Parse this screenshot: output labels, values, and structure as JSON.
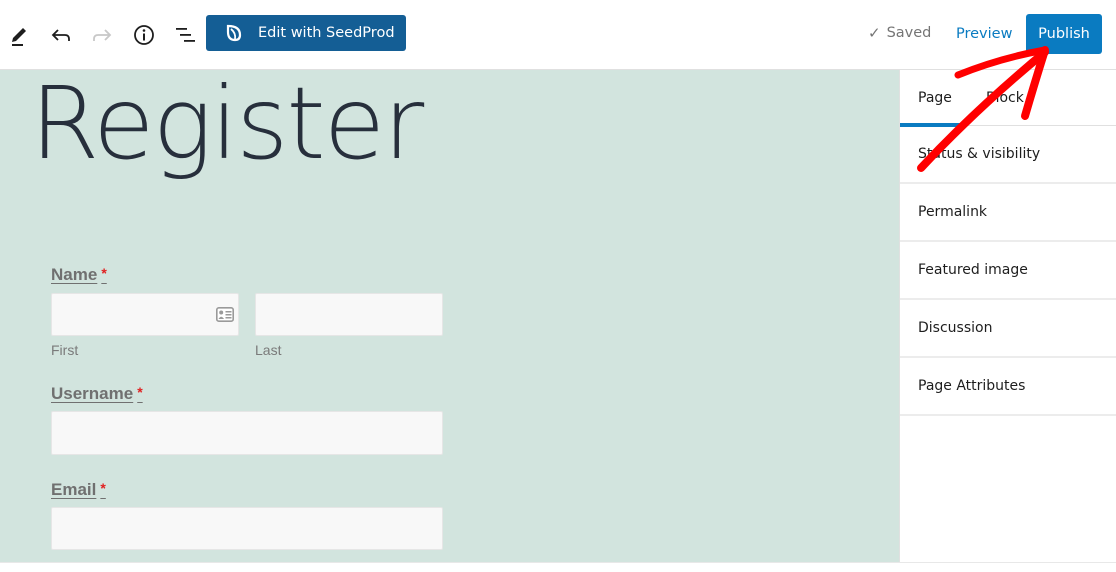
{
  "toolbar": {
    "tools": [
      {
        "name": "edit-tool",
        "icon": "pencil-icon"
      },
      {
        "name": "undo",
        "icon": "undo-icon"
      },
      {
        "name": "redo",
        "icon": "redo-icon",
        "disabled": true
      },
      {
        "name": "details",
        "icon": "info-icon"
      },
      {
        "name": "list-view",
        "icon": "list-view-icon"
      }
    ],
    "seedprod_label": "Edit with SeedProd",
    "saved_check": "✓",
    "saved_label": "Saved",
    "preview_label": "Preview",
    "publish_label": "Publish",
    "colors": {
      "seedprod": "#145e95",
      "publish": "#0a7bc1",
      "preview": "#0a7bc1"
    }
  },
  "canvas": {
    "background": "#d2e4de",
    "title": "Register",
    "form": {
      "name": {
        "label": "Name",
        "required": "*",
        "first_label": "First",
        "last_label": "Last",
        "first_value": "",
        "last_value": ""
      },
      "username": {
        "label": "Username",
        "required": "*",
        "value": ""
      },
      "email": {
        "label": "Email",
        "required": "*",
        "value": ""
      }
    }
  },
  "sidebar": {
    "tabs": [
      {
        "label": "Page",
        "active": true
      },
      {
        "label": "Block",
        "active": false
      }
    ],
    "panels": [
      {
        "label": "Status & visibility"
      },
      {
        "label": "Permalink"
      },
      {
        "label": "Featured image"
      },
      {
        "label": "Discussion"
      },
      {
        "label": "Page Attributes"
      }
    ]
  },
  "annotation": {
    "type": "hand-drawn-arrow",
    "color": "#ff0000",
    "points_to": "Publish"
  }
}
